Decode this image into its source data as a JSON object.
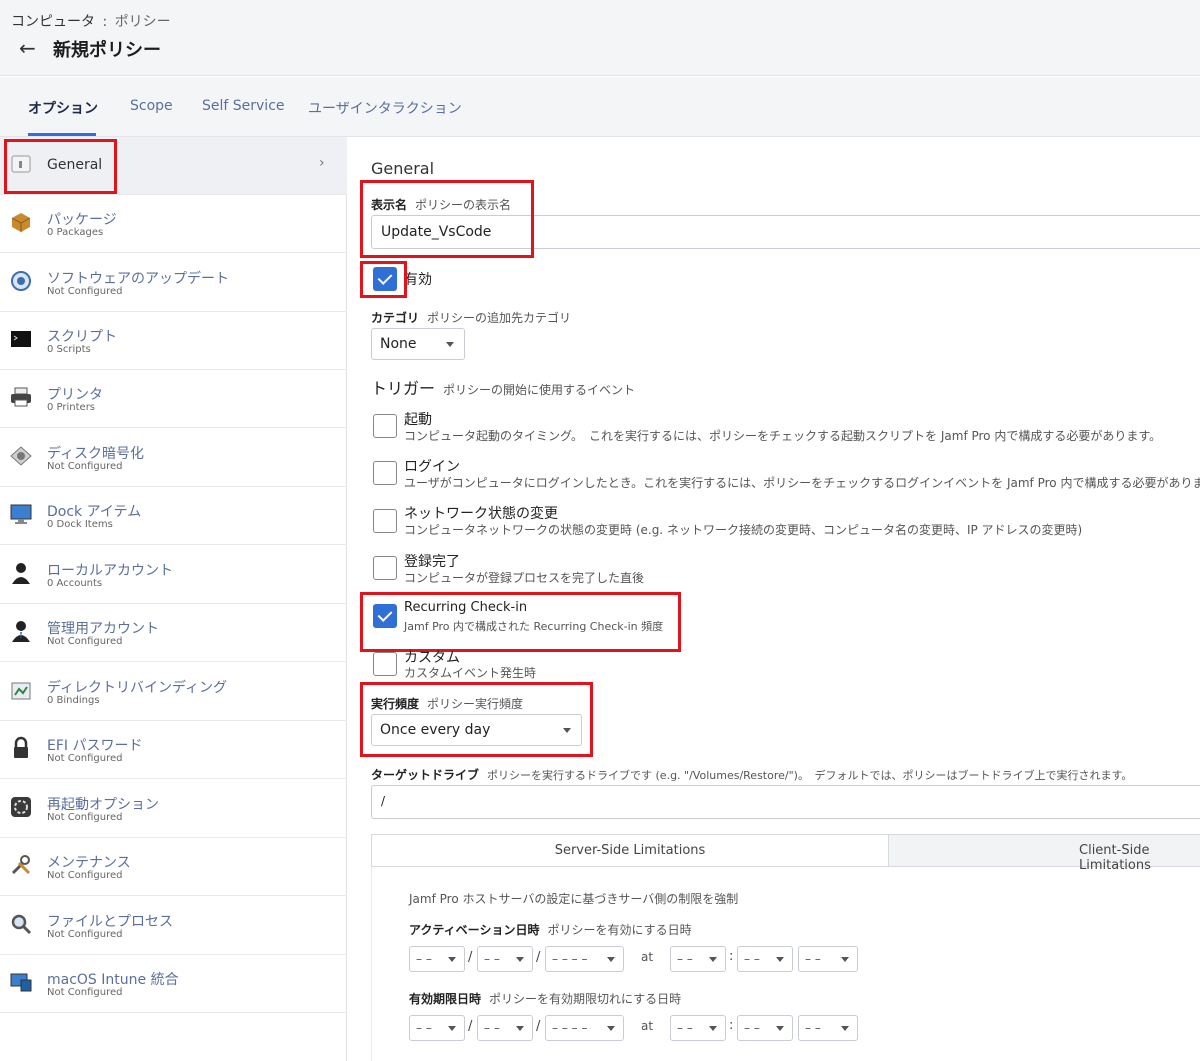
{
  "breadcrumb": {
    "parent": "コンピュータ",
    "sep": ":",
    "current": "ポリシー"
  },
  "header": {
    "back": "←",
    "title": "新規ポリシー"
  },
  "tabs": [
    {
      "label": "オプション",
      "active": true
    },
    {
      "label": "Scope"
    },
    {
      "label": "Self Service"
    },
    {
      "label": "ユーザインタラクション"
    }
  ],
  "sidebar": {
    "items": [
      {
        "label": "General",
        "sub": "",
        "icon": "general-icon",
        "selected": true
      },
      {
        "label": "パッケージ",
        "sub": "0 Packages",
        "icon": "package-icon"
      },
      {
        "label": "ソフトウェアのアップデート",
        "sub": "Not Configured",
        "icon": "software-update-icon"
      },
      {
        "label": "スクリプト",
        "sub": "0 Scripts",
        "icon": "script-icon"
      },
      {
        "label": "プリンタ",
        "sub": "0 Printers",
        "icon": "printer-icon"
      },
      {
        "label": "ディスク暗号化",
        "sub": "Not Configured",
        "icon": "disk-encryption-icon"
      },
      {
        "label": "Dock アイテム",
        "sub": "0 Dock Items",
        "icon": "dock-icon"
      },
      {
        "label": "ローカルアカウント",
        "sub": "0 Accounts",
        "icon": "local-account-icon"
      },
      {
        "label": "管理用アカウント",
        "sub": "Not Configured",
        "icon": "management-account-icon"
      },
      {
        "label": "ディレクトリバインディング",
        "sub": "0 Bindings",
        "icon": "directory-binding-icon"
      },
      {
        "label": "EFI パスワード",
        "sub": "Not Configured",
        "icon": "lock-icon"
      },
      {
        "label": "再起動オプション",
        "sub": "Not Configured",
        "icon": "restart-icon"
      },
      {
        "label": "メンテナンス",
        "sub": "Not Configured",
        "icon": "maintenance-icon"
      },
      {
        "label": "ファイルとプロセス",
        "sub": "Not Configured",
        "icon": "search-icon"
      },
      {
        "label": "macOS Intune 統合",
        "sub": "Not Configured",
        "icon": "intune-icon"
      }
    ],
    "chevron": "›"
  },
  "general": {
    "heading": "General",
    "display_name": {
      "label": "表示名",
      "hint": "ポリシーの表示名",
      "value": "Update_VsCode"
    },
    "enabled": {
      "label": "有効",
      "checked": true
    },
    "category": {
      "label": "カテゴリ",
      "hint": "ポリシーの追加先カテゴリ",
      "value": "None"
    },
    "trigger": {
      "label": "トリガー",
      "hint": "ポリシーの開始に使用するイベント",
      "items": [
        {
          "title": "起動",
          "desc": "コンピュータ起動のタイミング。　これを実行するには、ポリシーをチェックする起動スクリプトを Jamf Pro 内で構成する必要があります。",
          "checked": false
        },
        {
          "title": "ログイン",
          "desc": "ユーザがコンピュータにログインしたとき。これを実行するには、ポリシーをチェックするログインイベントを Jamf Pro 内で構成する必要があります",
          "checked": false
        },
        {
          "title": "ネットワーク状態の変更",
          "desc": "コンピュータネットワークの状態の変更時 (e.g. ネットワーク接続の変更時、コンピュータ名の変更時、IP アドレスの変更時)",
          "checked": false
        },
        {
          "title": "登録完了",
          "desc": "コンピュータが登録プロセスを完了した直後",
          "checked": false
        },
        {
          "title": "Recurring Check-in",
          "desc": "Jamf Pro 内で構成された Recurring Check-in 頻度",
          "checked": true
        },
        {
          "title": "カスタム",
          "desc": "カスタムイベント発生時",
          "checked": false
        }
      ]
    },
    "frequency": {
      "label": "実行頻度",
      "hint": "ポリシー実行頻度",
      "value": "Once every day"
    },
    "target_drive": {
      "label": "ターゲットドライブ",
      "hint": "ポリシーを実行するドライブです (e.g. \"/Volumes/Restore/\")。　デフォルトでは、ポリシーはブートドライブ上で実行されます。",
      "value": "/"
    },
    "limit_tabs": [
      {
        "label": "Server-Side Limitations",
        "active": true
      },
      {
        "label": "Client-Side Limitations"
      }
    ],
    "server_side": {
      "intro": "Jamf Pro ホストサーバの設定に基づきサーバ側の制限を強制",
      "activation": {
        "label": "アクティベーション日時",
        "hint": "ポリシーを有効にする日時"
      },
      "expiration": {
        "label": "有効期限日時",
        "hint": "ポリシーを有効期限切れにする日時"
      },
      "date_placeholders": {
        "month": "– –",
        "day": "– –",
        "year": "– – – –",
        "hour": "– –",
        "minute": "– –",
        "ampm": "– –"
      },
      "date_sep": "/",
      "time_sep": ":",
      "at": "at"
    }
  },
  "colors": {
    "accent": "#2f6fd6",
    "highlight": "#e0141c",
    "link": "#5b6f9c"
  }
}
